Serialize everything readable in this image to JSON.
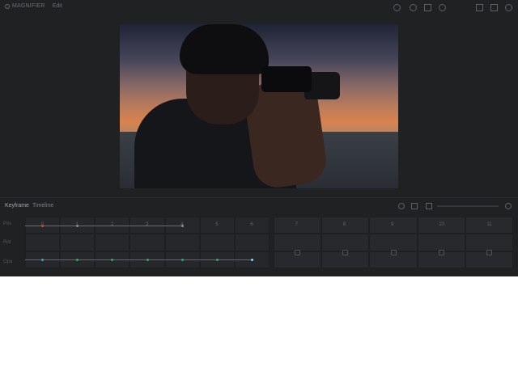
{
  "app": {
    "title": "MAGNIFIER",
    "tab": "Edit"
  },
  "preview": {
    "image_alt": "Silhouetted person taking a photo with a camera at sunset"
  },
  "panel": {
    "tabs": [
      {
        "label": "Keyframe"
      },
      {
        "label": "Timeline"
      }
    ]
  },
  "timeline": {
    "row_labels": [
      "Pos",
      "Rot",
      "Opa"
    ],
    "column_labels": [
      "0",
      "1",
      "2",
      "3",
      "4",
      "5",
      "6",
      "7",
      "8",
      "9",
      "10",
      "11"
    ],
    "tracks": [
      {
        "name": "Pos",
        "color": "#d2493f",
        "keyframes": [
          0,
          1,
          4
        ]
      },
      {
        "name": "Opa",
        "color": "#39a4cf",
        "keyframes": [
          0,
          1,
          2,
          3,
          4,
          5,
          6
        ]
      }
    ]
  },
  "colors": {
    "background": "#202123",
    "accent_red": "#d2493f",
    "accent_blue": "#39a4cf",
    "accent_green": "#3aa56b"
  }
}
